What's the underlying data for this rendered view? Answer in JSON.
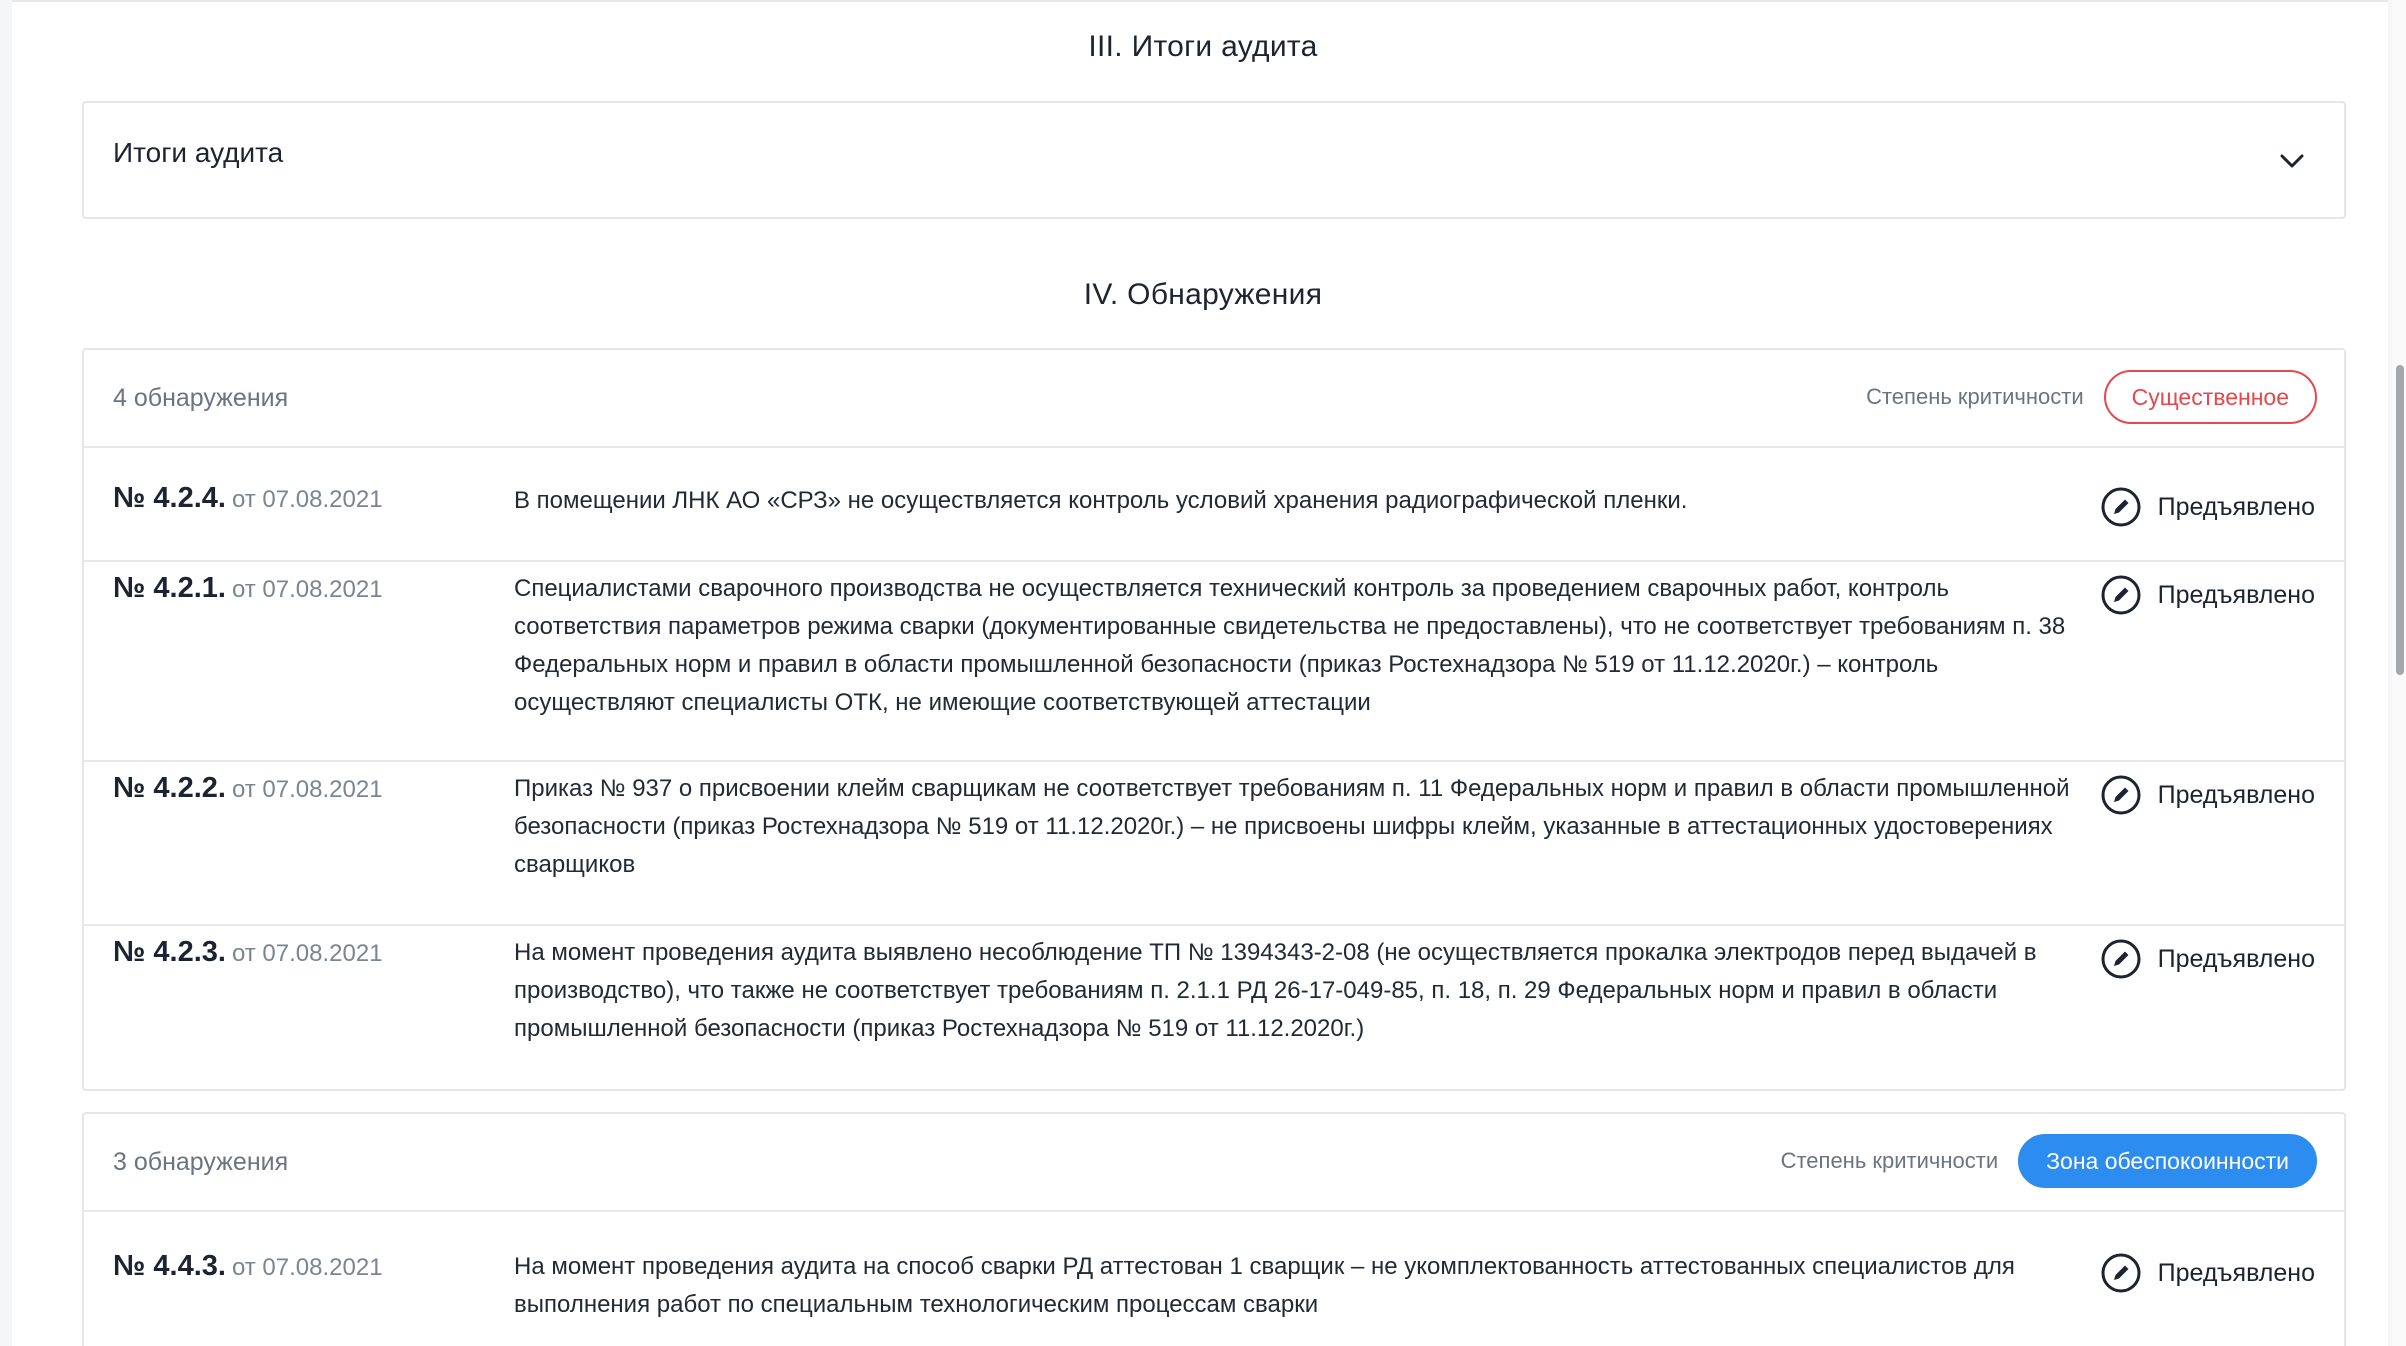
{
  "sections": {
    "summary_title": "III. Итоги аудита",
    "findings_title": "IV. Обнаружения"
  },
  "summary": {
    "label": "Итоги аудита"
  },
  "groups": [
    {
      "count": "4 обнаружения",
      "severity_label": "Степень критичности",
      "severity": "Существенное",
      "severity_color": "#e5484d",
      "items": [
        {
          "number": "№ 4.2.4.",
          "date": "от 07.08.2021",
          "text": "В помещении ЛНК АО «СРЗ» не осуществляется контроль условий хранения радиографической пленки.",
          "status": "Предъявлено"
        },
        {
          "number": "№ 4.2.1.",
          "date": "от 07.08.2021",
          "text": "Специалистами сварочного производства не осуществляется технический контроль за проведением сварочных работ, контроль соответствия параметров режима сварки (документированные свидетельства не предоставлены), что не соответствует требованиям п. 38 Федеральных норм и правил в области промышленной безопасности (приказ Ростехнадзора № 519 от 11.12.2020г.) – контроль осуществляют специалисты ОТК, не имеющие соответствующей аттестации",
          "status": "Предъявлено"
        },
        {
          "number": "№ 4.2.2.",
          "date": "от 07.08.2021",
          "text": "Приказ № 937 о присвоении клейм сварщикам не соответствует требованиям п. 11 Федеральных норм и правил в области промышленной безопасности (приказ Ростехнадзора № 519 от 11.12.2020г.) – не присвоены шифры клейм, указанные в аттестационных удостоверениях сварщиков",
          "status": "Предъявлено"
        },
        {
          "number": "№ 4.2.3.",
          "date": "от 07.08.2021",
          "text": "На момент проведения аудита выявлено несоблюдение ТП № 1394343-2-08 (не осуществляется прокалка электродов перед выдачей в производство), что также не соответствует требованиям п. 2.1.1 РД 26-17-049-85, п. 18, п. 29 Федеральных норм и правил в области промышленной безопасности (приказ Ростехнадзора № 519 от 11.12.2020г.)",
          "status": "Предъявлено"
        }
      ]
    },
    {
      "count": "3 обнаружения",
      "severity_label": "Степень критичности",
      "severity": "Зона обеспокоинности",
      "severity_color": "#2d8cf0",
      "items": [
        {
          "number": "№ 4.4.3.",
          "date": "от 07.08.2021",
          "text": "На момент проведения аудита на способ сварки РД аттестован 1 сварщик – не укомплектованность аттестованных специалистов для выполнения работ по специальным технологическим процессам сварки",
          "status": "Предъявлено"
        }
      ]
    }
  ],
  "icons": {
    "expand": "chevron-down-icon",
    "status": "pencil-circle-icon"
  }
}
